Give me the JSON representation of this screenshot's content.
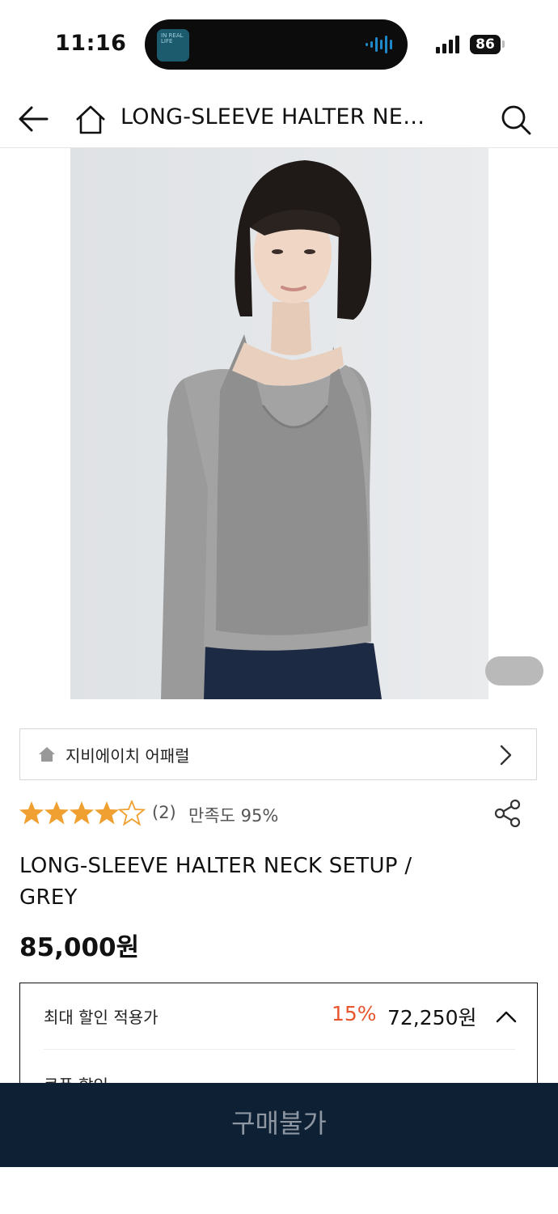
{
  "status_bar": {
    "time": "11:16",
    "island_app_label": "IN REAL LIFE",
    "battery": "86"
  },
  "header": {
    "title": "LONG-SLEEVE HALTER NECK SETUP / GREY",
    "icons": [
      "back-arrow-icon",
      "home-icon",
      "search-icon"
    ]
  },
  "product": {
    "image_alt": "Model wearing grey long-sleeve halter neck top",
    "brand": "지비에이치 어패럴",
    "rating": 4.5,
    "review_count": "(2)",
    "satisfaction": "만족도 95%",
    "title": "LONG-SLEEVE HALTER NECK SETUP / GREY",
    "price": "85,000원"
  },
  "discount": {
    "label": "최대 할인 적용가",
    "percent": "15%",
    "price": "72,250원",
    "coupon_label": "쿠폰 할인"
  },
  "bottom_bar": {
    "button_label": "구매불가"
  },
  "colors": {
    "accent_discount": "#e8552f",
    "bottom_bar": "#0e2034",
    "star": "#f0a030"
  }
}
